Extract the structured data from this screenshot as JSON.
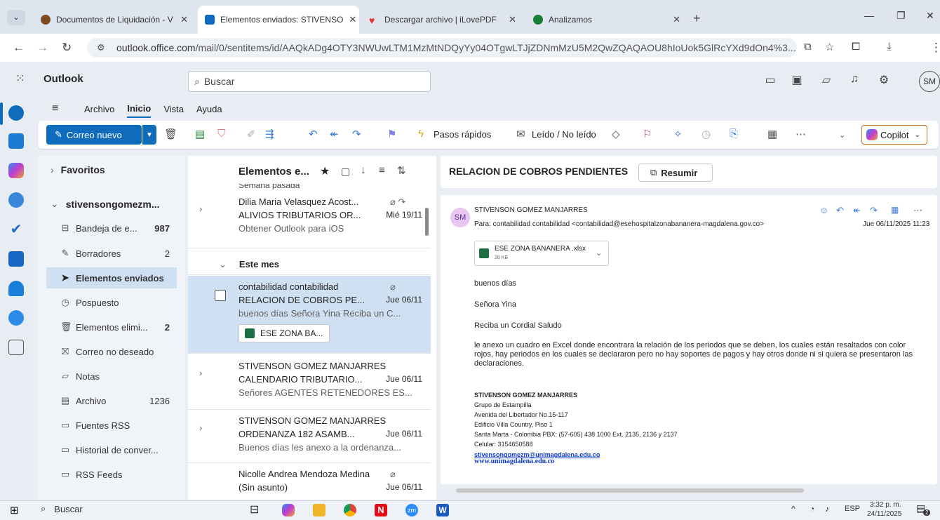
{
  "browser": {
    "tabs": [
      {
        "label": "Documentos de Liquidación - V"
      },
      {
        "label": "Elementos enviados: STIVENSO"
      },
      {
        "label": "Descargar archivo | iLovePDF"
      },
      {
        "label": "Analizamos"
      }
    ],
    "url_host": "outlook.office.com",
    "url_path": "/mail/0/sentitems/id/AAQkADg4OTY3NWUwLTM1MzMtNDQyYy04OTgwLTJjZDNmMzU5M2QwZQAQAOU8hIoUok5GlRcYXd9dOn4%3..."
  },
  "app": {
    "title": "Outlook",
    "search_placeholder": "Buscar",
    "avatar_initials": "SM"
  },
  "ribbon": {
    "tabs": [
      "Archivo",
      "Inicio",
      "Vista",
      "Ayuda"
    ],
    "new_mail": "Correo nuevo",
    "quick_steps": "Pasos rápidos",
    "read_unread": "Leído / No leído",
    "copilot": "Copilot"
  },
  "folders": {
    "favorites": "Favoritos",
    "account": "stivensongomezm...",
    "items": [
      {
        "label": "Bandeja de e...",
        "count": "987"
      },
      {
        "label": "Borradores",
        "count": "2"
      },
      {
        "label": "Elementos enviados",
        "count": ""
      },
      {
        "label": "Pospuesto",
        "count": ""
      },
      {
        "label": "Elementos elimi...",
        "count": "2"
      },
      {
        "label": "Correo no deseado",
        "count": ""
      },
      {
        "label": "Notas",
        "count": ""
      },
      {
        "label": "Archivo",
        "count": "1236"
      },
      {
        "label": "Fuentes RSS",
        "count": ""
      },
      {
        "label": "Historial de conver...",
        "count": ""
      },
      {
        "label": "RSS Feeds",
        "count": ""
      }
    ]
  },
  "list": {
    "title": "Elementos e...",
    "group_prev": "Semana pasada",
    "group_month": "Este mes",
    "messages": [
      {
        "sender": "Dilia Maria Velasquez Acost...",
        "subject": "ALIVIOS TRIBUTARIOS OR...",
        "date": "Mié 19/11",
        "preview": "Obtener Outlook para iOS"
      },
      {
        "sender": "contabilidad contabilidad",
        "subject": "RELACION DE COBROS PE...",
        "date": "Jue 06/11",
        "preview": "buenos días Señora Yina Reciba un C...",
        "attachment": "ESE ZONA BA..."
      },
      {
        "sender": "STIVENSON GOMEZ MANJARRES",
        "subject": "CALENDARIO TRIBUTARIO...",
        "date": "Jue 06/11",
        "preview": "Señores AGENTES RETENEDORES ES..."
      },
      {
        "sender": "STIVENSON GOMEZ MANJARRES",
        "subject": "ORDENANZA 182 ASAMB...",
        "date": "Jue 06/11",
        "preview": "Buenos días les anexo a la ordenanza..."
      },
      {
        "sender": "Nicolle Andrea Mendoza Medina",
        "subject": "(Sin asunto)",
        "date": "Jue 06/11",
        "preview": ""
      }
    ]
  },
  "reading": {
    "subject": "RELACION DE COBROS PENDIENTES",
    "summarize": "Resumir",
    "from": "STIVENSON GOMEZ MANJARRES",
    "from_initials": "SM",
    "to": "Para:  contabilidad contabilidad <contabilidad@esehospitalzonabananera-magdalena.gov.co>",
    "date": "Jue 06/11/2025 11:23",
    "attachment_name": "ESE ZONA BANANERA .xlsx",
    "attachment_size": "28 KB",
    "body": [
      "buenos días",
      "Señora Yina",
      "Reciba un Cordial Saludo",
      "le anexo un cuadro en Excel donde encontrara la relación de los periodos que se deben, los cuales están resaltados con color rojos, hay periodos en los cuales se declararon pero no hay soportes de pagos y hay otros donde ni si quiera se presentaron las declaraciones."
    ],
    "signature": {
      "name": "STIVENSON GOMEZ MANJARRES",
      "lines": [
        "Grupo de Estampilla",
        "Avenida del Libertador No.15-117",
        "Edificio Villa Country, Piso 1",
        "Santa Marta - Colombia PBX: (57-605) 438 1000 Ext. 2135, 2136 y 2137",
        "Celular: 3154650588"
      ],
      "email": "stivensongomezm@unimagdalena.edu.co",
      "web": "www.unimagdalena.edu.co"
    }
  },
  "taskbar": {
    "search": "Buscar",
    "lang": "ESP",
    "time": "3:32 p. m.",
    "date": "24/11/2025",
    "notif": "2"
  }
}
